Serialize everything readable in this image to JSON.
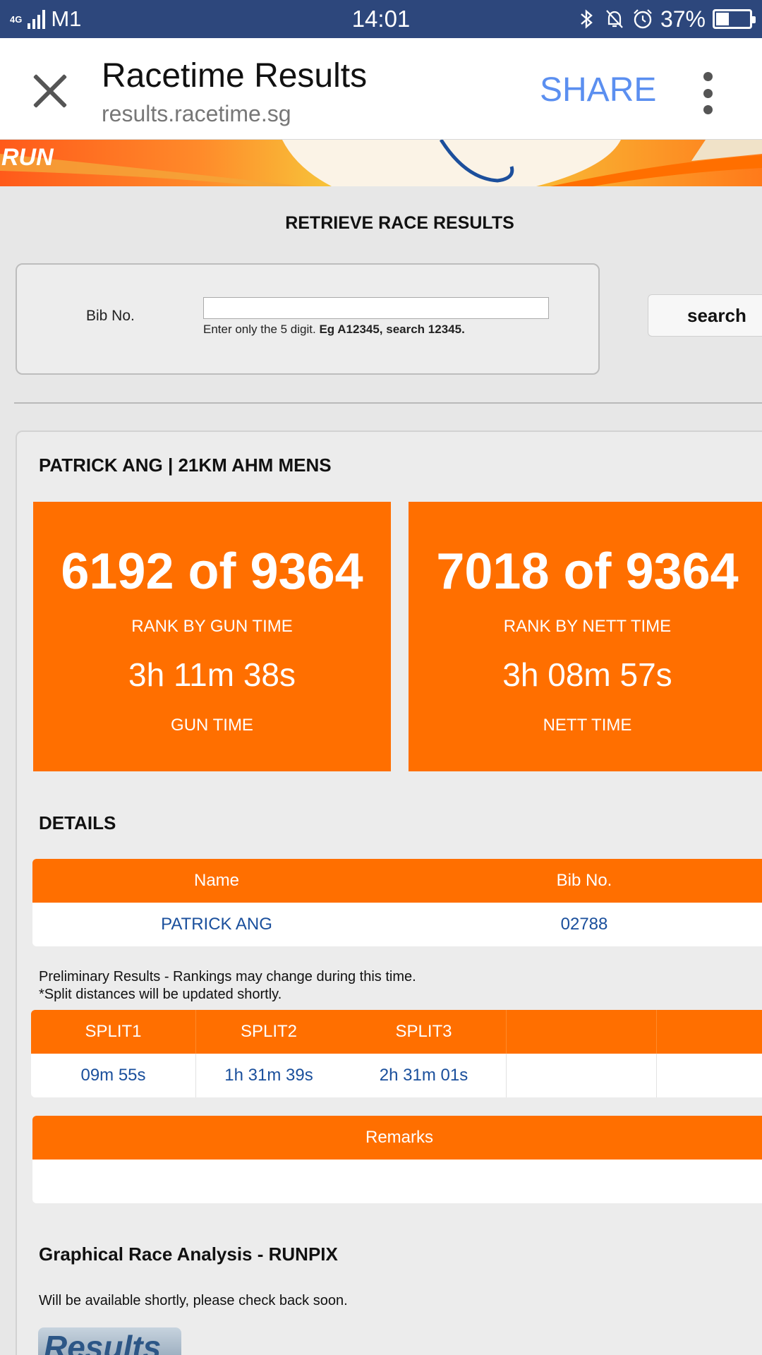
{
  "status_bar": {
    "network": "4G",
    "carrier": "M1",
    "time": "14:01",
    "battery": "37%",
    "battery_level": 0.37,
    "icons": [
      "bluetooth-icon",
      "bell-muted-icon",
      "alarm-icon",
      "battery-icon"
    ]
  },
  "app_bar": {
    "title": "Racetime Results",
    "url": "results.racetime.sg",
    "share_label": "SHARE",
    "icons": [
      "close-icon",
      "more-vert-icon"
    ]
  },
  "banner": {
    "text": "RUN",
    "colors": {
      "orange": "#ff6f00",
      "yellow": "#f5b21c",
      "blue": "#1c4f9c"
    }
  },
  "retrieve": {
    "title": "RETRIEVE RACE RESULTS",
    "bib_label": "Bib No.",
    "bib_value": "",
    "hint_prefix": "Enter only the 5 digit. ",
    "hint_bold": "Eg A12345, search 12345.",
    "search_label": "search"
  },
  "runner": {
    "heading": "PATRICK ANG | 21KM AHM MENS",
    "gun": {
      "rank": "6192 of 9364",
      "rank_label": "RANK BY GUN TIME",
      "time": "3h 11m 38s",
      "time_label": "GUN TIME"
    },
    "nett": {
      "rank": "7018 of 9364",
      "rank_label": "RANK BY NETT TIME",
      "time": "3h 08m 57s",
      "time_label": "NETT TIME"
    }
  },
  "details": {
    "heading": "DETAILS",
    "columns": [
      "Name",
      "Bib No."
    ],
    "row": [
      "PATRICK ANG",
      "02788"
    ]
  },
  "notes": {
    "line1": "Preliminary Results - Rankings may change during this time.",
    "line2": "*Split distances will be updated shortly."
  },
  "splits": {
    "columns": [
      "SPLIT1",
      "SPLIT2",
      "SPLIT3",
      "",
      ""
    ],
    "row": [
      "09m 55s",
      "1h 31m 39s",
      "2h 31m 01s",
      "",
      ""
    ]
  },
  "remarks": {
    "header": "Remarks",
    "value": ""
  },
  "runpix": {
    "heading": "Graphical Race Analysis - RUNPIX",
    "note": "Will be available shortly, please check back soon.",
    "logo_text": "Results"
  },
  "colors": {
    "accent": "#ff6f00",
    "link": "#1a4f9c",
    "statusbar": "#2d477c",
    "share": "#5b8ff0"
  }
}
